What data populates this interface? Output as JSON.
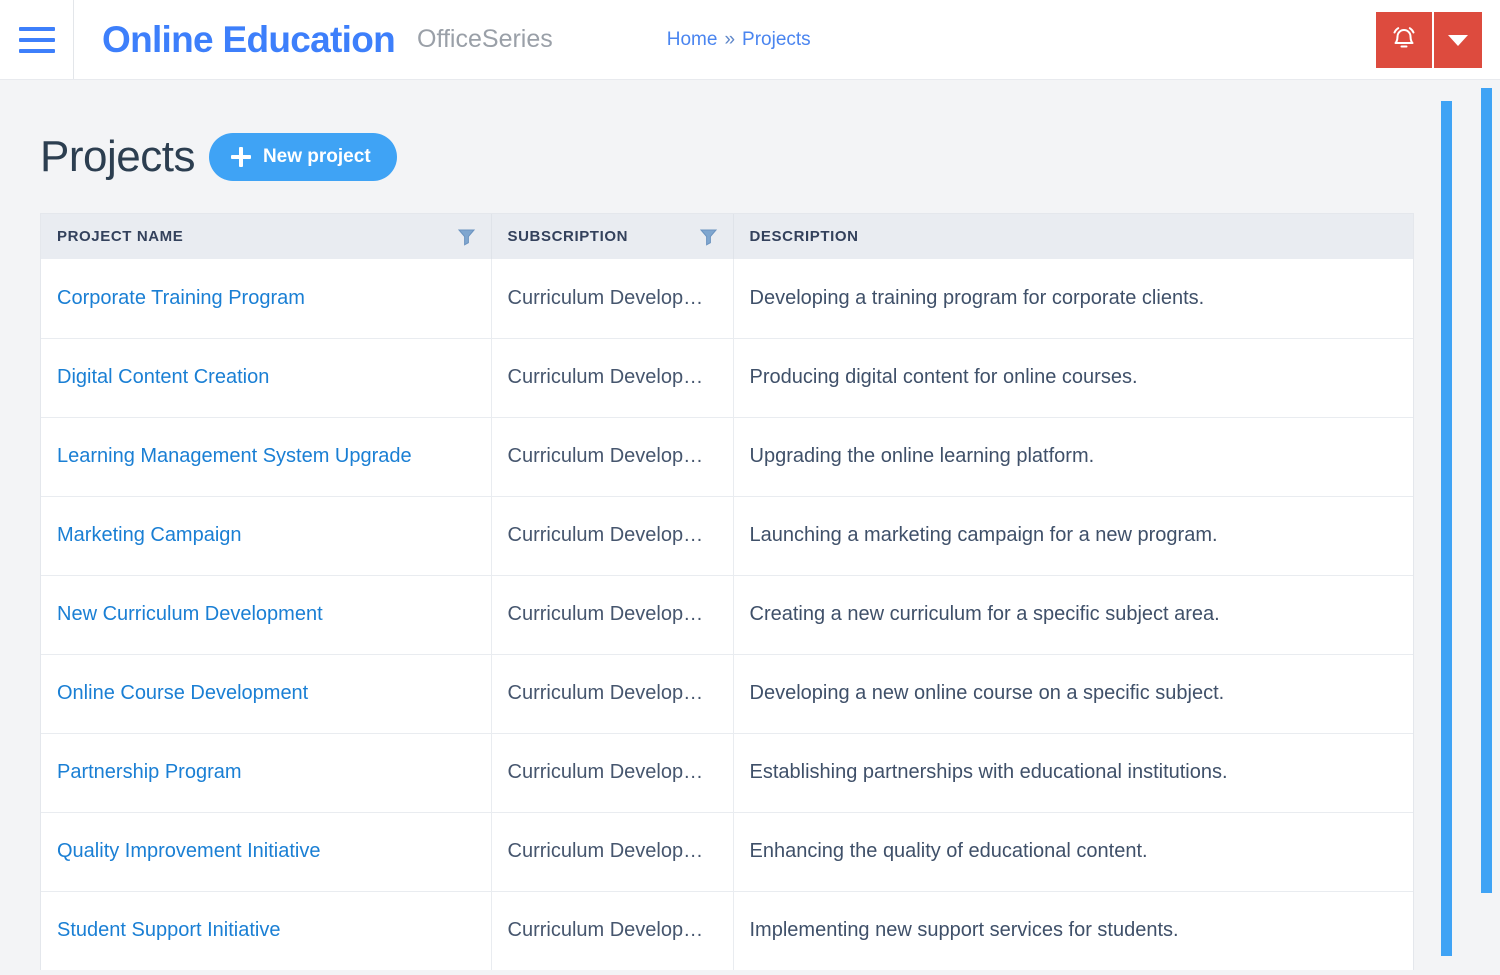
{
  "header": {
    "menu_icon": "hamburger-menu-icon",
    "brand_title": "Online Education",
    "brand_subtitle": "OfficeSeries",
    "breadcrumb": {
      "home": "Home",
      "separator": "»",
      "current": "Projects"
    },
    "actions": {
      "notification_icon": "bell-icon",
      "dropdown_icon": "chevron-down-icon",
      "accent_color": "#dd4b3e"
    },
    "brand_color": "#3d7ffb"
  },
  "page": {
    "title": "Projects",
    "new_project_label": "New project",
    "new_project_icon": "plus-icon",
    "accent_color": "#3fa3f5"
  },
  "table": {
    "columns": [
      {
        "label": "PROJECT NAME",
        "filterable": true,
        "filter_icon": "filter-funnel-icon"
      },
      {
        "label": "SUBSCRIPTION",
        "filterable": true,
        "filter_icon": "filter-funnel-icon"
      },
      {
        "label": "DESCRIPTION",
        "filterable": false,
        "filter_icon": ""
      }
    ],
    "rows": [
      {
        "name": "Corporate Training Program",
        "subscription": "Curriculum Developm…",
        "description": "Developing a training program for corporate clients."
      },
      {
        "name": "Digital Content Creation",
        "subscription": "Curriculum Developm…",
        "description": "Producing digital content for online courses."
      },
      {
        "name": "Learning Management System Upgrade",
        "subscription": "Curriculum Developm…",
        "description": "Upgrading the online learning platform."
      },
      {
        "name": "Marketing Campaign",
        "subscription": "Curriculum Developm…",
        "description": "Launching a marketing campaign for a new program."
      },
      {
        "name": "New Curriculum Development",
        "subscription": "Curriculum Developm…",
        "description": "Creating a new curriculum for a specific subject area."
      },
      {
        "name": "Online Course Development",
        "subscription": "Curriculum Developm…",
        "description": "Developing a new online course on a specific subject."
      },
      {
        "name": "Partnership Program",
        "subscription": "Curriculum Developm…",
        "description": "Establishing partnerships with educational institutions."
      },
      {
        "name": "Quality Improvement Initiative",
        "subscription": "Curriculum Developm…",
        "description": "Enhancing the quality of educational content."
      },
      {
        "name": "Student Support Initiative",
        "subscription": "Curriculum Developm…",
        "description": "Implementing new support services for students."
      }
    ]
  },
  "scrollbars": {
    "color": "#3fa3f5",
    "inner_name": "inner-vertical-scrollbar",
    "outer_name": "page-vertical-scrollbar"
  }
}
